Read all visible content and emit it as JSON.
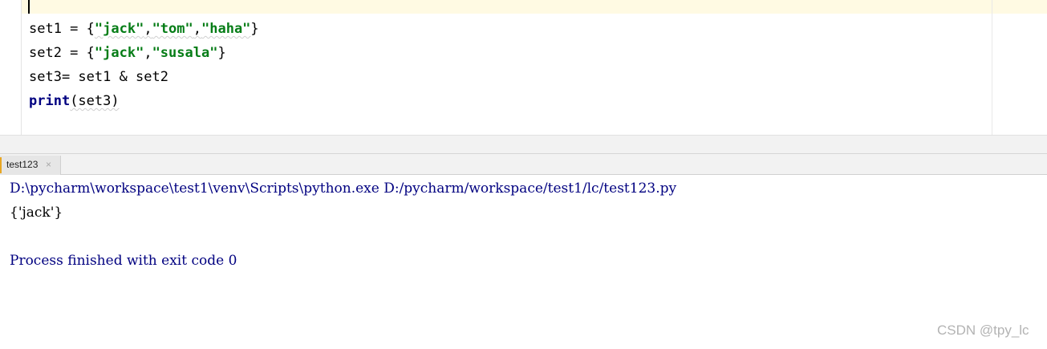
{
  "editor": {
    "line1": {
      "lhs": "set1 = {",
      "s1": "\"jack\"",
      "c1": ",",
      "s2": "\"tom\"",
      "c2": ",",
      "s3": "\"haha\"",
      "close": "}"
    },
    "line2": {
      "lhs": "set2 = {",
      "s1": "\"jack\"",
      "c1": ",",
      "s2": "\"susala\"",
      "close": "}"
    },
    "line3": {
      "text": "set3= set1 & set2"
    },
    "line4": {
      "kw": "print",
      "arg": "(set3)"
    }
  },
  "run_tab": {
    "label": "test123",
    "close_glyph": "×"
  },
  "console": {
    "command": "D:\\pycharm\\workspace\\test1\\venv\\Scripts\\python.exe D:/pycharm/workspace/test1/lc/test123.py",
    "output": "{'jack'}",
    "exit_message": "Process finished with exit code 0"
  },
  "watermark": "CSDN @tpy_lc",
  "colors": {
    "string": "#067d17",
    "keyword": "#000080",
    "current_line": "#fffae3",
    "console_system": "#000080"
  }
}
